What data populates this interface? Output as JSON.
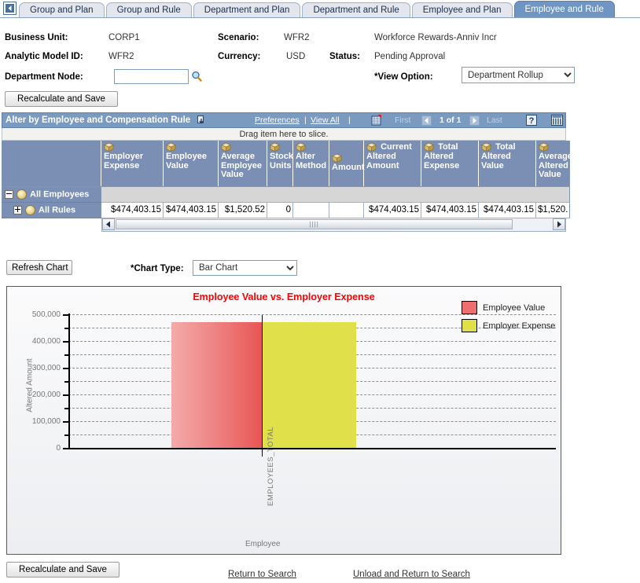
{
  "tabs": {
    "back_icon": "back-arrow-icon",
    "items": [
      {
        "label": "Group and Plan",
        "active": false
      },
      {
        "label": "Group and Rule",
        "active": false
      },
      {
        "label": "Department and Plan",
        "active": false
      },
      {
        "label": "Department and Rule",
        "active": false
      },
      {
        "label": "Employee and Plan",
        "active": false
      },
      {
        "label": "Employee and Rule",
        "active": true
      }
    ]
  },
  "header": {
    "business_unit_label": "Business Unit:",
    "business_unit_value": "CORP1",
    "analytic_model_label": "Analytic Model ID:",
    "analytic_model_value": "WFR2",
    "department_node_label": "Department Node:",
    "department_node_value": "",
    "department_node_placeholder": "",
    "lookup_icon": "magnifier-icon",
    "scenario_label": "Scenario:",
    "scenario_value": "WFR2",
    "scenario_desc": "Workforce Rewards-Anniv Incr",
    "currency_label": "Currency:",
    "currency_value": "USD",
    "status_label": "Status:",
    "status_value": "Pending Approval",
    "view_option_label": "*View Option:",
    "view_option_value": "Department Rollup",
    "view_option_options": [
      "Department Rollup"
    ],
    "recalculate_top_label": "Recalculate and Save"
  },
  "grid": {
    "title": "Alter by Employee and Compensation Rule",
    "title_icon": "download-to-excel-icon",
    "preferences_label": "Preferences",
    "separator1": "|",
    "view_all_label": "View All",
    "separator2": "|",
    "grid_icon": "find-icon",
    "first_label": "First",
    "prev_icon": "previous-page-icon",
    "counter": "1 of 1",
    "next_icon": "next-page-icon",
    "last_label": "Last",
    "help_icon": "help-icon",
    "personalize_icon": "personalize-grid-icon",
    "slice_hint": "Drag item here to slice.",
    "columns": [
      "Employer Expense",
      "Employee Value",
      "Average Employee Value",
      "Stock Units",
      "Alter Method",
      "Amount",
      "Current Altered Amount",
      "Total Altered Expense",
      "Total Altered Value",
      "Average Altered Value"
    ],
    "rows": [
      {
        "node_label": "All Employees",
        "toggle": "minus",
        "level": 0,
        "values": [
          "",
          "",
          "",
          "",
          "",
          "",
          "",
          "",
          "",
          ""
        ]
      },
      {
        "node_label": "All Rules",
        "toggle": "plus",
        "level": 1,
        "values": [
          "$474,403.15",
          "$474,403.15",
          "$1,520.52",
          "0",
          "",
          "",
          "$474,403.15",
          "$474,403.15",
          "$474,403.15",
          "$1,520."
        ]
      }
    ],
    "scrollbar": {
      "left_icon": "scroll-left-icon",
      "right_icon": "scroll-right-icon",
      "thumb_glyph": "||||"
    }
  },
  "chart_controls": {
    "refresh_label": "Refresh Chart",
    "chart_type_label": "*Chart Type:",
    "chart_type_value": "Bar Chart",
    "chart_type_options": [
      "Bar Chart"
    ]
  },
  "chart_data": {
    "type": "bar",
    "title": "Employee Value vs. Employer Expense",
    "xlabel": "Employee",
    "ylabel": "Altered Amount",
    "categories": [
      "EMPLOYEES_TOTAL"
    ],
    "series": [
      {
        "name": "Employee Value",
        "values": [
          474403.15
        ],
        "color": "#ef6f6f"
      },
      {
        "name": "Employer Expense",
        "values": [
          474403.15
        ],
        "color": "#e0e04a"
      }
    ],
    "ylim": [
      0,
      500000
    ],
    "ytick_labels": [
      "500,000",
      "400,000",
      "300,000",
      "200,000",
      "100,000",
      "0"
    ],
    "ytick_values": [
      500000,
      400000,
      300000,
      200000,
      100000,
      0
    ],
    "minor_tick_values": [
      450000,
      350000,
      250000,
      150000,
      50000
    ],
    "grid": true,
    "legend_position": "top-right",
    "title_color": "#ff0000"
  },
  "footer": {
    "recalculate_label": "Recalculate and Save",
    "return_to_search_label": "Return to Search",
    "unload_and_return_label": "Unload and Return to Search"
  }
}
